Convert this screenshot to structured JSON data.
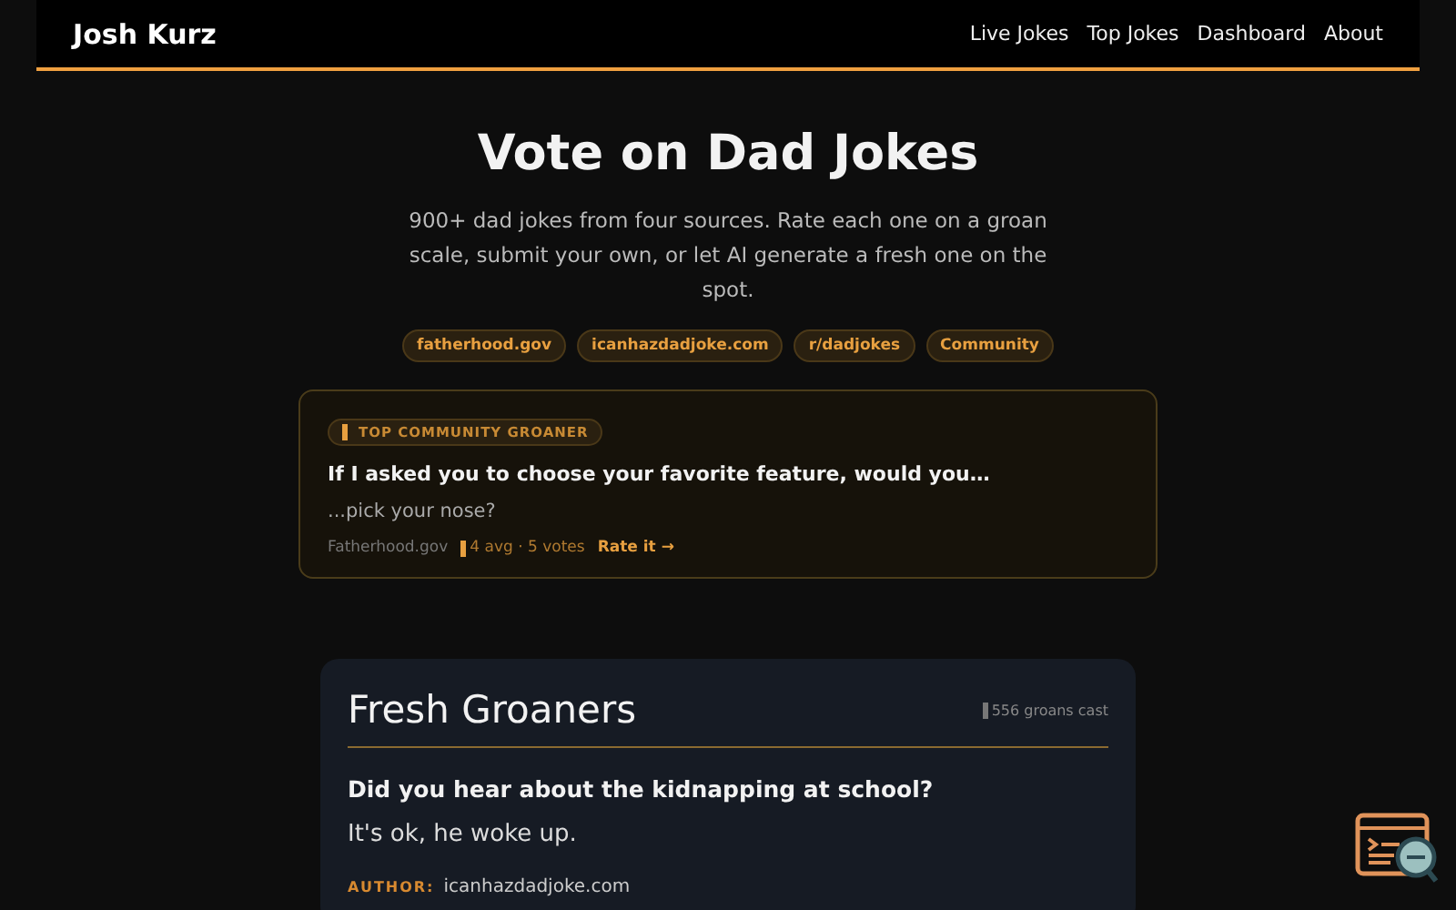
{
  "header": {
    "brand": "Josh Kurz",
    "nav": [
      "Live Jokes",
      "Top Jokes",
      "Dashboard",
      "About"
    ]
  },
  "hero": {
    "title": "Vote on Dad Jokes",
    "subtitle": "900+ dad jokes from four sources. Rate each one on a groan scale, submit your own, or let AI generate a fresh one on the spot.",
    "sources": [
      "fatherhood.gov",
      "icanhazdadjoke.com",
      "r/dadjokes",
      "Community"
    ]
  },
  "featured": {
    "badge": "TOP COMMUNITY GROANER",
    "setup": "If I asked you to choose your favorite feature, would you…",
    "punchline": "...pick your nose?",
    "source": "Fatherhood.gov",
    "stats": "4 avg · 5 votes",
    "link": "Rate it →"
  },
  "fresh": {
    "title": "Fresh Groaners",
    "count": "556 groans cast",
    "setup": "Did you hear about the kidnapping at school?",
    "punchline": "It's ok, he woke up.",
    "author_label": "AUTHOR:",
    "author": "icanhazdadjoke.com"
  }
}
